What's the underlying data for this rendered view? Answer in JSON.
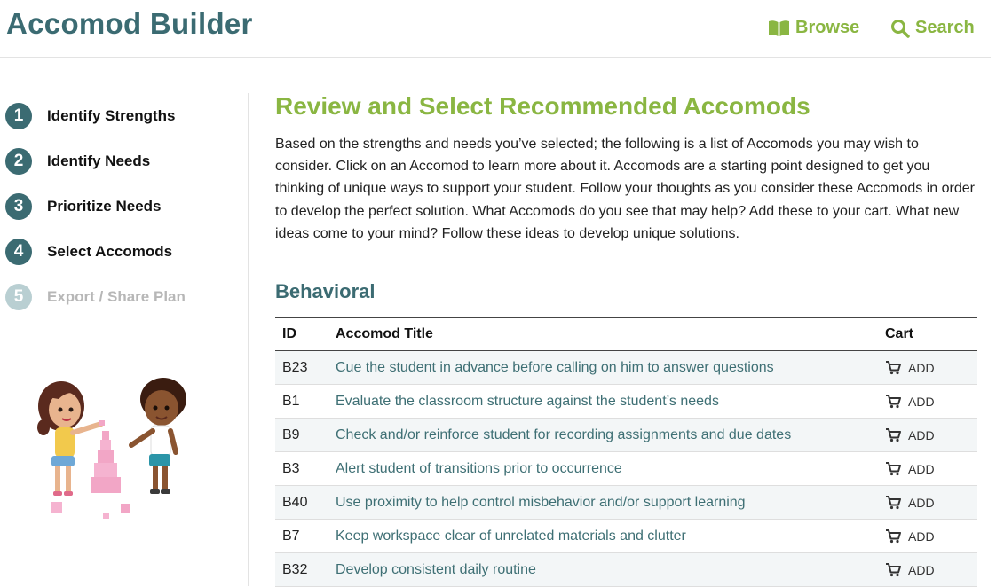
{
  "app": {
    "title": "Accomod Builder"
  },
  "nav": {
    "browse": "Browse",
    "search": "Search"
  },
  "steps": [
    {
      "num": "1",
      "label": "Identify Strengths"
    },
    {
      "num": "2",
      "label": "Identify Needs"
    },
    {
      "num": "3",
      "label": "Prioritize Needs"
    },
    {
      "num": "4",
      "label": "Select Accomods"
    },
    {
      "num": "5",
      "label": "Export / Share Plan"
    }
  ],
  "main": {
    "title": "Review and Select Recommended Accomods",
    "intro": "Based on the strengths and needs you’ve selected; the following is a list of Accomods you may wish to consider. Click on an Accomod to learn more about it. Accomods are a starting point designed to get you thinking of unique ways to support your student. Follow your thoughts as you consider these Accomods in order to develop the perfect solution. What Accomods do you see that may help? Add these to your cart. What new ideas come to your mind? Follow these ideas to develop unique solutions.",
    "section": "Behavioral"
  },
  "table": {
    "headers": {
      "id": "ID",
      "title": "Accomod Title",
      "cart": "Cart"
    },
    "add_label": "ADD",
    "rows": [
      {
        "id": "B23",
        "title": "Cue the student in advance before calling on him to answer questions"
      },
      {
        "id": "B1",
        "title": "Evaluate the classroom structure against the student’s needs"
      },
      {
        "id": "B9",
        "title": "Check and/or reinforce student for recording assignments and due dates"
      },
      {
        "id": "B3",
        "title": "Alert student of transitions prior to occurrence"
      },
      {
        "id": "B40",
        "title": "Use proximity to help control misbehavior and/or support learning"
      },
      {
        "id": "B7",
        "title": "Keep workspace clear of unrelated materials and clutter"
      },
      {
        "id": "B32",
        "title": "Develop consistent daily routine"
      }
    ]
  },
  "colors": {
    "brand_teal": "#3b6b72",
    "accent_green": "#8ab642",
    "disabled": "#b9cfd2"
  }
}
